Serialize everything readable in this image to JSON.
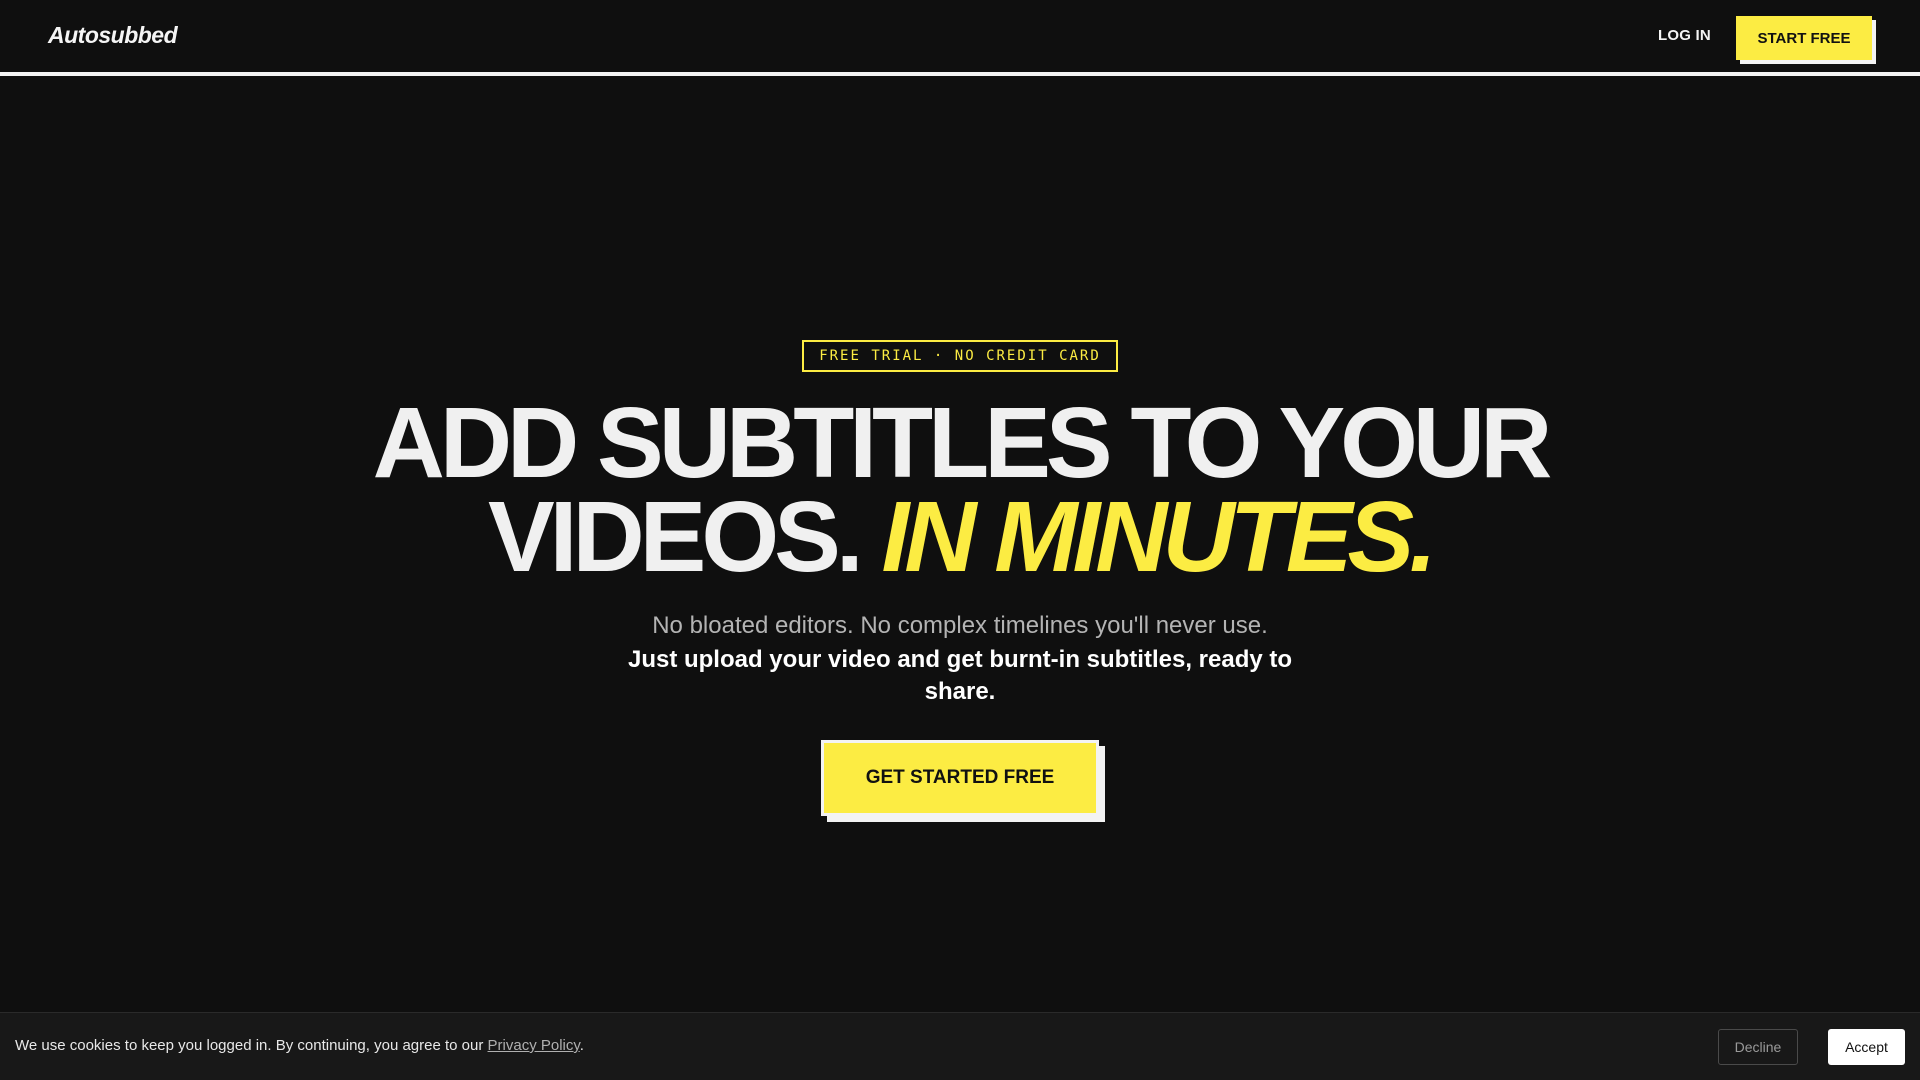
{
  "nav": {
    "logo": "Autosubbed",
    "login_label": "LOG IN",
    "start_label": "START FREE"
  },
  "hero": {
    "badge": "FREE TRIAL · NO CREDIT CARD",
    "headline_line1": "ADD SUBTITLES TO YOUR",
    "headline_line2_plain": "VIDEOS. ",
    "headline_line2_accent": "IN MINUTES.",
    "subtitle_light": "No bloated editors. No complex timelines you'll never use.",
    "subtitle_bold": "Just upload your video and get burnt-in subtitles, ready to share.",
    "cta_label": "GET STARTED FREE"
  },
  "cookie": {
    "text": "We use cookies to keep you logged in. By continuing, you agree to our ",
    "link_label": "Privacy Policy",
    "period": ".",
    "decline_label": "Decline",
    "accept_label": "Accept"
  },
  "colors": {
    "background": "#0f0f0f",
    "accent_yellow": "#fcec43",
    "text_white": "#f2f2f2",
    "text_muted": "#b4b4b4"
  }
}
